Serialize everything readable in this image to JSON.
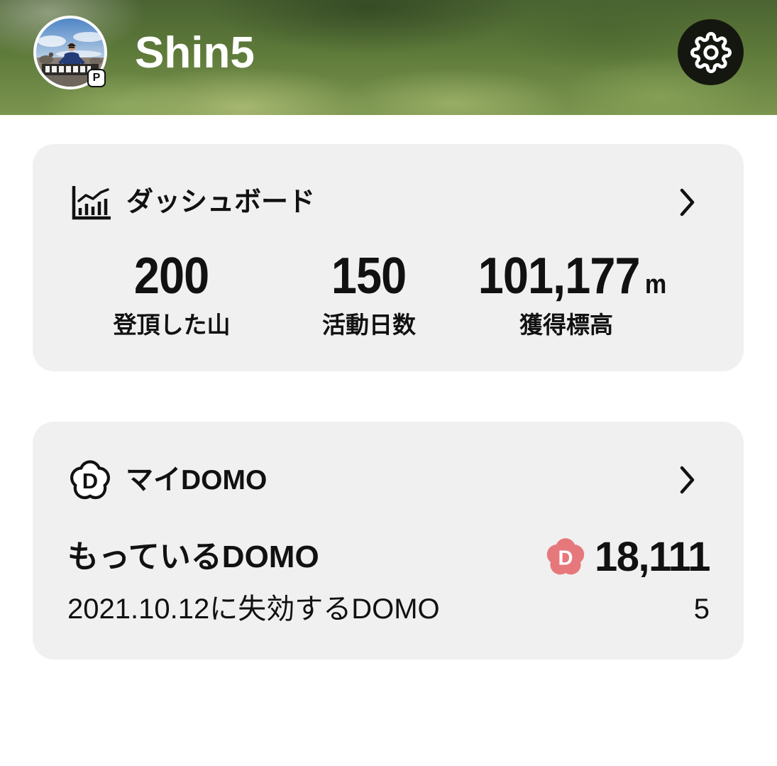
{
  "header": {
    "username": "Shin5",
    "avatar_badge": "P",
    "avatar_icon": "profile-photo",
    "settings_icon": "gear-icon"
  },
  "dashboard": {
    "title": "ダッシュボード",
    "icon": "bar-chart-icon",
    "chevron_icon": "chevron-right-icon",
    "stats": [
      {
        "value": "200",
        "label": "登頂した山"
      },
      {
        "value": "150",
        "label": "活動日数"
      },
      {
        "value": "101,177",
        "unit": "m",
        "label": "獲得標高"
      }
    ]
  },
  "my_domo": {
    "title": "マイDOMO",
    "icon": "domo-flower-icon",
    "icon_letter": "D",
    "chevron_icon": "chevron-right-icon",
    "owned_label": "もっているDOMO",
    "owned_icon": "domo-coin-icon",
    "owned_value": "18,111",
    "expiring_label": "2021.10.12に失効するDOMO",
    "expiring_value": "5"
  },
  "colors": {
    "page_bg": "#ffffff",
    "card_bg": "#f0f0f0",
    "text": "#111111",
    "header_text": "#ffffff",
    "settings_button_bg": "#14170f",
    "domo_pink": "#e6787b"
  }
}
